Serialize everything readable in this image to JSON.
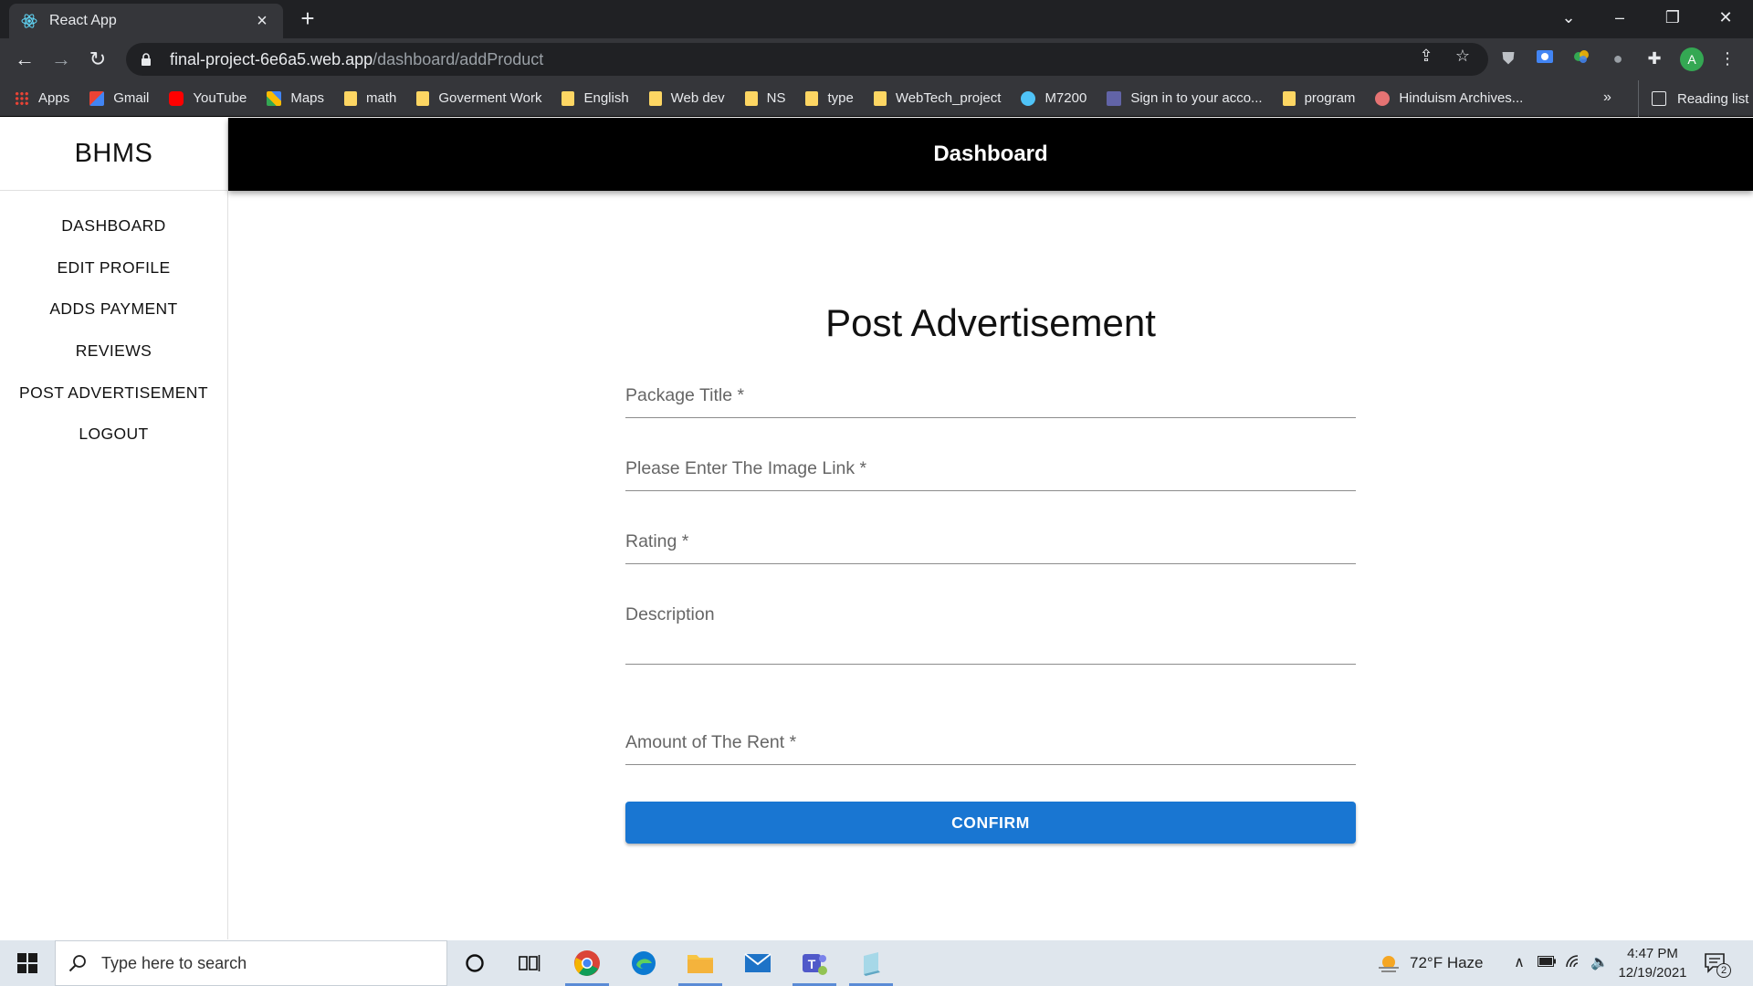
{
  "browser": {
    "tab_title": "React App",
    "url_host": "final-project-6e6a5.web.app",
    "url_path": "/dashboard/addProduct",
    "bookmarks": [
      "Apps",
      "Gmail",
      "YouTube",
      "Maps",
      "math",
      "Goverment Work",
      "English",
      "Web dev",
      "NS",
      "type",
      "WebTech_project",
      "M7200",
      "Sign in to your acco...",
      "program",
      "Hinduism Archives..."
    ],
    "overflow_label": "»",
    "reading_list": "Reading list",
    "profile_initial": "A"
  },
  "app": {
    "brand": "BHMS",
    "header_title": "Dashboard",
    "nav": [
      "DASHBOARD",
      "EDIT PROFILE",
      "ADDS PAYMENT",
      "REVIEWS",
      "POST ADVERTISEMENT",
      "LOGOUT"
    ]
  },
  "form": {
    "title": "Post Advertisement",
    "fields": {
      "package_title": {
        "label": "Package Title *",
        "value": ""
      },
      "image_link": {
        "label": "Please Enter The Image Link *",
        "value": ""
      },
      "rating": {
        "label": "Rating *",
        "value": ""
      },
      "description": {
        "label": "Description",
        "value": ""
      },
      "rent_amount": {
        "label": "Amount of The Rent *",
        "value": ""
      }
    },
    "confirm_label": "CONFIRM"
  },
  "taskbar": {
    "search_placeholder": "Type here to search",
    "weather": "72°F  Haze",
    "time": "4:47 PM",
    "date": "12/19/2021",
    "notification_count": "2"
  },
  "colors": {
    "primary": "#1976d2",
    "header_bg": "#000000",
    "browser_dark": "#202124",
    "browser_toolbar": "#35363a"
  }
}
